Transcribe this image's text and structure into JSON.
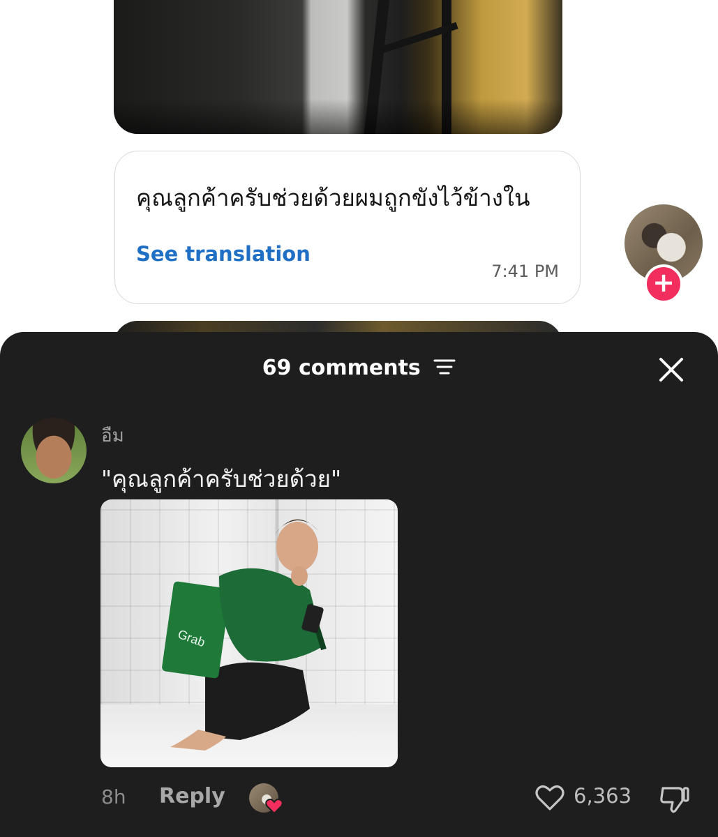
{
  "chat": {
    "message_text": "คุณลูกค้าครับช่วยด้วยผมถูกขังไว้ข้างใน",
    "see_translation": "See translation",
    "time": "7:41 PM",
    "follow_plus": "+"
  },
  "comments": {
    "header_title": "69 comments",
    "items": [
      {
        "username": "อืม",
        "text": "\"คุณลูกค้าครับช่วยด้วย\"",
        "age": "8h",
        "reply_label": "Reply",
        "like_count": "6,363",
        "image_text": "Grab"
      }
    ]
  },
  "colors": {
    "sheet_bg": "#1e1e1e",
    "link_blue": "#1f6fc4",
    "follow_red": "#f22e5f",
    "heart_red": "#f22e5f"
  },
  "icons": [
    "sort-icon",
    "close-icon",
    "heart-outline-icon",
    "thumbs-down-icon",
    "heart-filled-icon",
    "plus-icon"
  ]
}
